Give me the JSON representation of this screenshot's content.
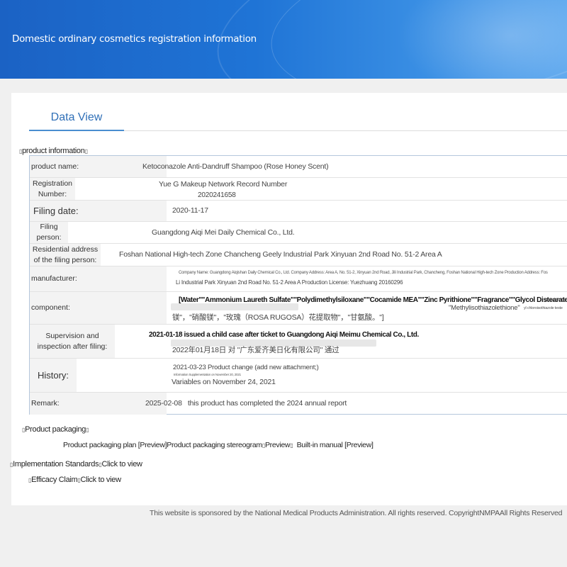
{
  "header": {
    "title": "Domestic ordinary cosmetics registration information"
  },
  "tabs": [
    {
      "label": "Data View"
    }
  ],
  "sections": {
    "product_information": "product information",
    "product_packaging": "Product packaging",
    "implementation_standards": "Implementation Standards",
    "implementation_click": "Click to view",
    "efficacy_claim": "Efficacy Claim",
    "efficacy_click": "Click to view"
  },
  "table": {
    "product_name": {
      "label": "product name:",
      "value": "Ketoconazole Anti-Dandruff Shampoo (Rose Honey Scent)"
    },
    "registration_number": {
      "label": "Registration Number:",
      "value_line1": "Yue G Makeup Network Record Number",
      "value_line2": "2020241658"
    },
    "filing_date": {
      "label": "Filing date:",
      "value": "2020-11-17"
    },
    "filing_person": {
      "label": "Filing person:",
      "value": "Guangdong Aiqi Mei Daily Chemical Co., Ltd."
    },
    "residential_address": {
      "label": "Residential address of the filing person:",
      "value": "Foshan National High-tech Zone Chancheng Geely Industrial Park Xinyuan 2nd Road No. 51-2 Area A"
    },
    "manufacturer": {
      "label": "manufacturer:",
      "value_line1": "Company Name: Guangdong Aiqishan Daily Chemical Co., Ltd. Company Address: Area A, No. 51-2, Xinyuan 2nd Road, Jili Industrial Park, Chancheng, Foshan National High-tech Zone Production Address: Fos",
      "value_line2": "Li Industrial Park Xinyuan 2nd Road No. 51-2 Area A Production License: Yuezhuang 20160296"
    },
    "component": {
      "label": "component:",
      "value_line1": "[Water\"\"Ammonium Laureth Sulfate\"\"Polydimethylsiloxane\"\"Cocamide MEA\"\"Zinc Pyrithione\"\"Fragrance\"\"Glycol Distearate\"",
      "value_line1_tail": "chlorid  Dd Co",
      "value_line2_tail": "\"Methylisothiazolethione\"",
      "value_line2_tail_small": "yl chloroisothiazole teste",
      "value_line3": "镁\"，\"硝酸镁\"，\"玫瑰（ROSA RUGOSA）花提取物\"，\"甘氨酸。\"]"
    },
    "supervision": {
      "label": "Supervision and inspection after filing:",
      "value_line1": "2021-01-18 issued a child case after ticket to Guangdong Aiqi Meimu Chemical Co., Ltd.",
      "value_line2": "2022年01月18日 对 \"广东爱齐美日化有限公司\" 通过"
    },
    "history": {
      "label": "History:",
      "value_line1": "2021-03-23 Product change (add new attachment;)",
      "value_line2": "Information Supplementation on November 20, 2021",
      "value_line3": "Variables on November 24, 2021"
    },
    "remark": {
      "label": "Remark:",
      "value": "2025-02-08   this product has completed the 2024 annual report"
    }
  },
  "packaging": {
    "plan": "Product packaging plan [Preview]",
    "stereogram": "Product packaging stereogram",
    "stereogram_preview": "Preview",
    "manual": "Built-in manual [Preview]"
  },
  "footer": {
    "text": "This website is sponsored by the National Medical Products Administration. All rights reserved. CopyrightNMPAAll Rights Reserved"
  },
  "colors": {
    "banner": "#1f74d6",
    "tab_text": "#2f6fb7",
    "tab_underline": "#4a8ed0",
    "table_border": "#b5c7dc",
    "label_bg": "#f3f3f3"
  }
}
